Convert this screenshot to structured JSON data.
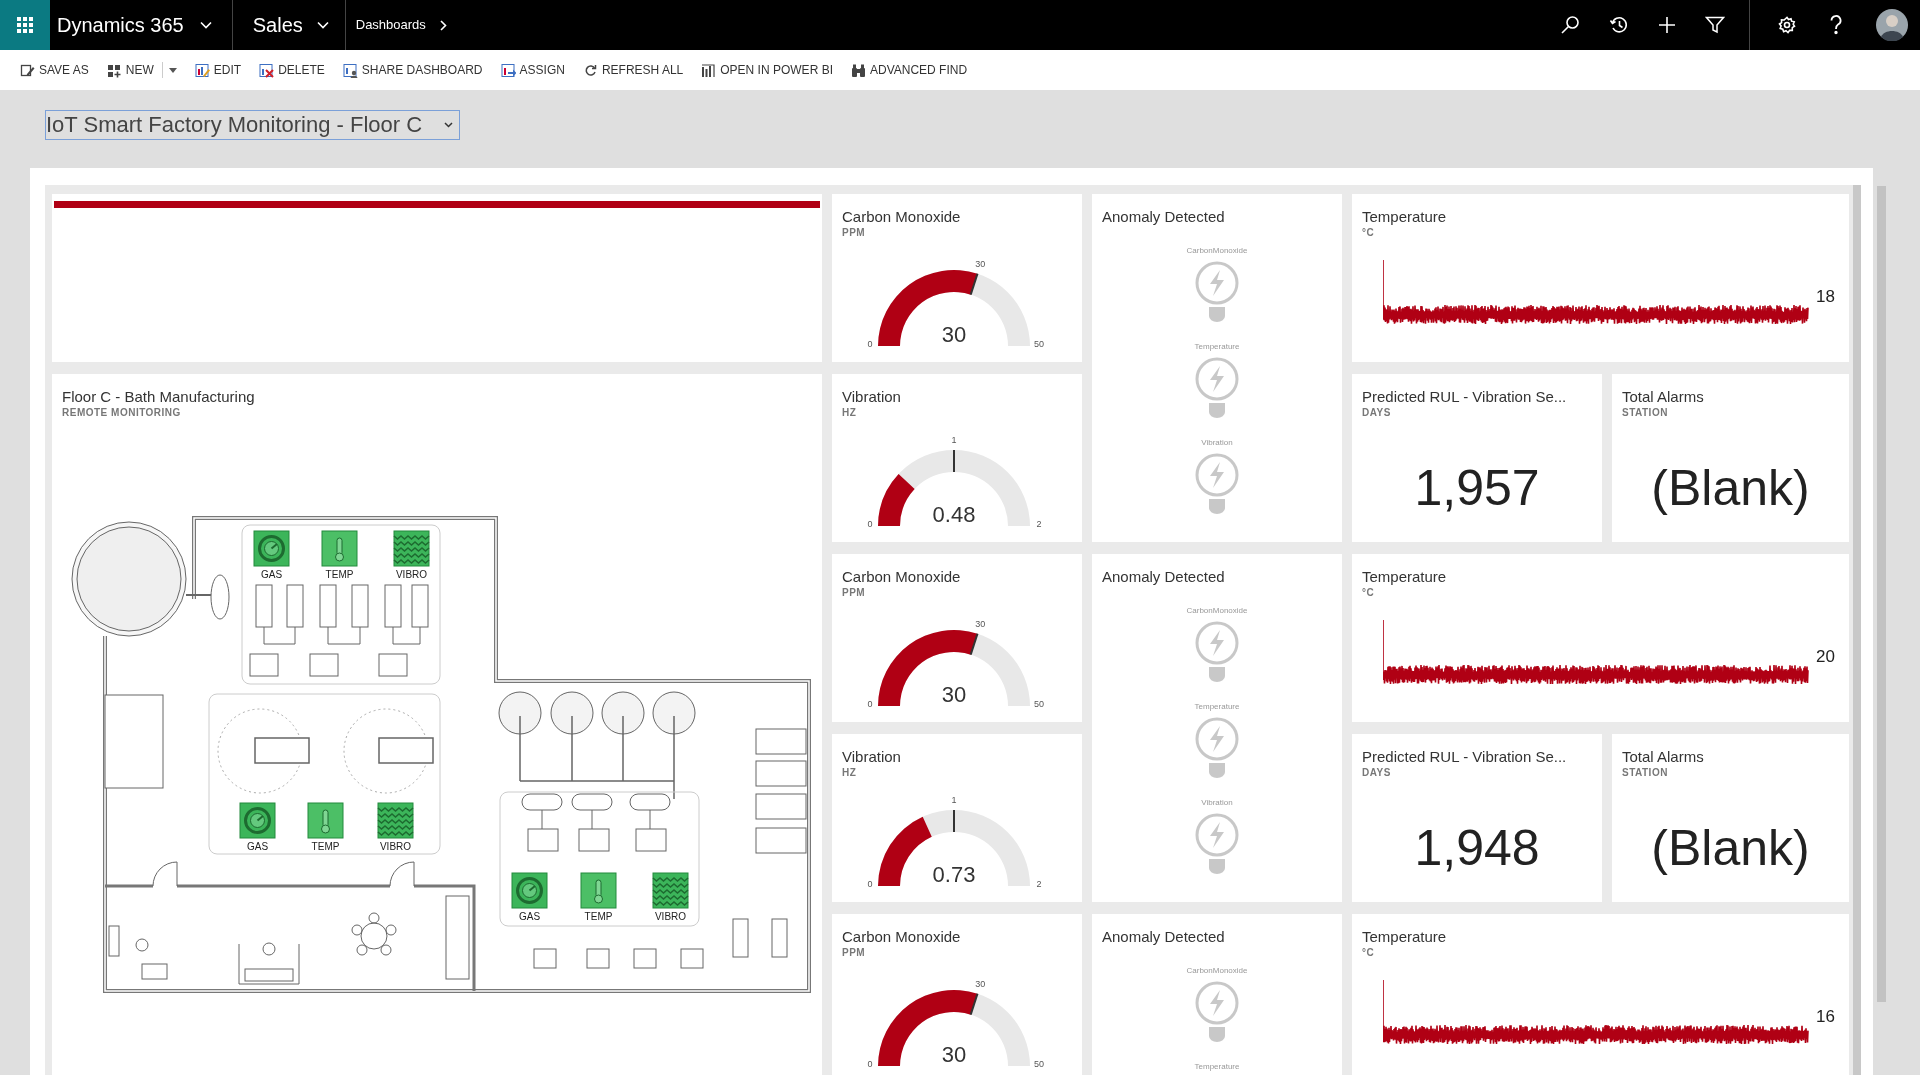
{
  "nav": {
    "app_name": "Dynamics 365",
    "area": "Sales",
    "breadcrumb": "Dashboards"
  },
  "toolbar": [
    {
      "kind": "save_as",
      "label": "SAVE AS"
    },
    {
      "kind": "new",
      "label": "NEW"
    },
    {
      "kind": "dropdown"
    },
    {
      "kind": "edit",
      "label": "EDIT"
    },
    {
      "kind": "delete",
      "label": "DELETE"
    },
    {
      "kind": "share",
      "label": "SHARE DASHBOARD"
    },
    {
      "kind": "assign",
      "label": "ASSIGN"
    },
    {
      "kind": "refresh",
      "label": "REFRESH ALL"
    },
    {
      "kind": "power_bi",
      "label": "OPEN IN POWER BI"
    },
    {
      "kind": "advanced_find",
      "label": "ADVANCED FIND"
    }
  ],
  "dashboard_selector": {
    "value": "IoT Smart Factory Monitoring - Floor C"
  },
  "floor_plan": {
    "title": "Floor C - Bath Manufacturing",
    "subtitle": "REMOTE MONITORING",
    "sensor_panels": [
      {
        "sensors": [
          {
            "kind": "gas",
            "label": "GAS"
          },
          {
            "kind": "temp",
            "label": "TEMP"
          },
          {
            "kind": "vibro",
            "label": "VIBRO"
          }
        ]
      },
      {
        "sensors": [
          {
            "kind": "gas",
            "label": "GAS"
          },
          {
            "kind": "temp",
            "label": "TEMP"
          },
          {
            "kind": "vibro",
            "label": "VIBRO"
          }
        ]
      },
      {
        "sensors": [
          {
            "kind": "gas",
            "label": "GAS"
          },
          {
            "kind": "temp",
            "label": "TEMP"
          },
          {
            "kind": "vibro",
            "label": "VIBRO"
          }
        ]
      }
    ]
  },
  "stations": [
    {
      "co": {
        "title": "Carbon Monoxide",
        "unit": "PPM",
        "value": "30",
        "min": "0",
        "max": "50",
        "target": "30",
        "level": 0.6
      },
      "vibration": {
        "title": "Vibration",
        "unit": "HZ",
        "value": "0.48",
        "min": "0",
        "max": "2",
        "target": "1",
        "level": 0.24
      },
      "anomaly": {
        "title": "Anomaly Detected",
        "sensors": [
          {
            "label": "CarbonMonoxide"
          },
          {
            "label": "Temperature"
          },
          {
            "label": "Vibration"
          }
        ]
      },
      "temperature": {
        "title": "Temperature",
        "unit": "°C",
        "value": "18"
      },
      "rul": {
        "title": "Predicted RUL - Vibration Se...",
        "unit": "DAYS",
        "value": "1,957"
      },
      "alarms": {
        "title": "Total Alarms",
        "unit": "STATION",
        "value": "(Blank)"
      }
    },
    {
      "co": {
        "title": "Carbon Monoxide",
        "unit": "PPM",
        "value": "30",
        "min": "0",
        "max": "50",
        "target": "30",
        "level": 0.6
      },
      "vibration": {
        "title": "Vibration",
        "unit": "HZ",
        "value": "0.73",
        "min": "0",
        "max": "2",
        "target": "1",
        "level": 0.365
      },
      "anomaly": {
        "title": "Anomaly Detected",
        "sensors": [
          {
            "label": "CarbonMonoxide"
          },
          {
            "label": "Temperature"
          },
          {
            "label": "Vibration"
          }
        ]
      },
      "temperature": {
        "title": "Temperature",
        "unit": "°C",
        "value": "20"
      },
      "rul": {
        "title": "Predicted RUL - Vibration Se...",
        "unit": "DAYS",
        "value": "1,948"
      },
      "alarms": {
        "title": "Total Alarms",
        "unit": "STATION",
        "value": "(Blank)"
      }
    },
    {
      "co": {
        "title": "Carbon Monoxide",
        "unit": "PPM",
        "value": "30",
        "min": "0",
        "max": "50",
        "target": "30",
        "level": 0.6
      },
      "anomaly": {
        "title": "Anomaly Detected",
        "sensors": [
          {
            "label": "CarbonMonoxide"
          },
          {
            "label": "Temperature"
          }
        ]
      },
      "temperature": {
        "title": "Temperature",
        "unit": "°C",
        "value": "16"
      }
    }
  ]
}
